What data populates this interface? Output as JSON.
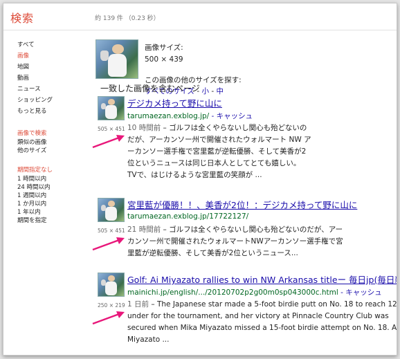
{
  "header": {
    "logo": "検索",
    "stats": "約 139 件 （0.23 秒）"
  },
  "sidebar": {
    "items": [
      "すべて",
      "画像",
      "地図",
      "動画",
      "ニュース",
      "ショッピング",
      "もっと見る"
    ],
    "active_index": 1,
    "search_header": "画像で検索",
    "search_items": [
      "類似の画像",
      "他のサイズ"
    ],
    "period_header": "期間指定なし",
    "period_items": [
      "1 時間以内",
      "24 時間以内",
      "1 週間以内",
      "1 か月以内",
      "1 年以内",
      "期間を指定"
    ]
  },
  "image_info": {
    "label": "画像サイズ:",
    "size": "500 × 439",
    "other_sizes_label": "この画像の他のサイズを探す:",
    "all": "すべてのサイズ",
    "sep1": " - ",
    "small": "小",
    "sep2": " - ",
    "medium": "中"
  },
  "section_title": "一致した画像を含むページ",
  "results": [
    {
      "title": "デジカメ持って野に山に",
      "url": "tarumaezan.exblog.jp/",
      "cache": " - キャッシュ",
      "dims": "505 × 451",
      "time": "10 時間前",
      "snippet_lines": [
        " – ゴルフは全くやらないし関心も殆どないの",
        "だが、アーカンソー州で開催されたウォルマート NW ア",
        "ーカンソー選手権で宮里藍が逆転優勝、そして美香が2",
        "位というニュースは同じ日本人としてとても嬉しい。",
        "TVで、はじけるような宮里藍の笑顔が ..."
      ]
    },
    {
      "title": "宮里藍が優勝！！、美香が2位！：デジカメ持って野に山に",
      "url": "tarumaezan.exblog.jp/17722127/",
      "cache": "",
      "dims": "505 × 451",
      "time": "21 時間前",
      "snippet_lines": [
        " – ゴルフは全くやらないし関心も殆どないのだが、アー",
        "カンソー州で開催されたウォルマートNWアーカンソー選手権で宮",
        "里藍が逆転優勝、そして美香が2位というニュース..."
      ]
    },
    {
      "title": "Golf: Ai Miyazato rallies to win NW Arkansas titleー 毎日jp(毎日新聞)",
      "url": "mainichi.jp/english/.../20120702p2g00m0sp043000c.html",
      "cache": " - キャッシュ",
      "dims": "250 × 219",
      "time": "1 日前",
      "snippet_lines": [
        " – The Japanese star made a 5-foot birdie putt on No. 18 to reach 12",
        "under for the tournament, and her victory at Pinnacle Country Club was",
        "secured when Mika Miyazato missed a 15-foot birdie attempt on No. 18. Ai",
        "Miyazato ..."
      ]
    }
  ],
  "colors": {
    "brand_red": "#dd4b39",
    "link": "#1a0dab",
    "url_green": "#006621",
    "annotation_arrow": "#e8177a"
  }
}
